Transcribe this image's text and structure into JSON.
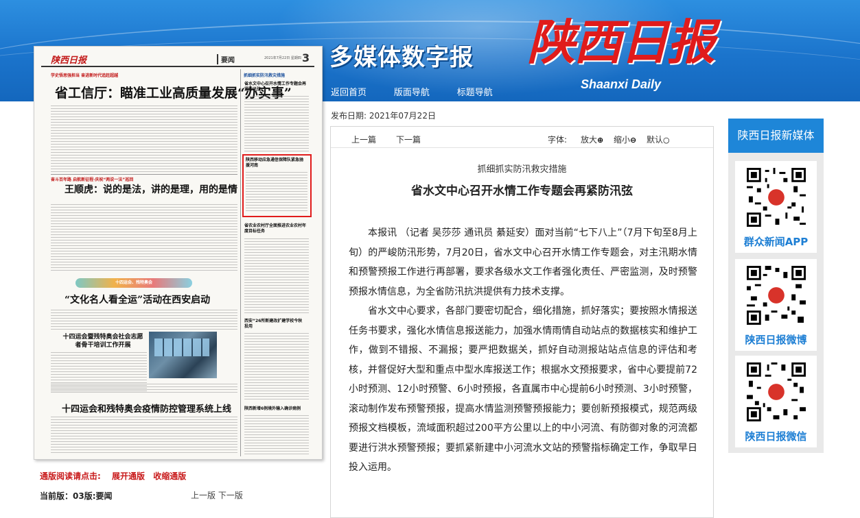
{
  "header": {
    "site_title": "多媒体数字报",
    "logo_cn": "陕西日报",
    "logo_en": "Shaanxi Daily",
    "nav": [
      "返回首页",
      "版面导航",
      "标题导航"
    ]
  },
  "newspaper_page": {
    "masthead_logo": "陕西日报",
    "section": "要闻",
    "date": "2021年7月22日 星期四",
    "page_number": "3",
    "kicker_1": "学史悟思强担当 奋进新时代追赶超越",
    "headline_1": "省工信厅：瞄准工业高质量发展“办实事”",
    "kicker_2": "奋斗百年路 启航新征程·庆祝“两说一法”巡回",
    "headline_2": "王顺虎：说的是法，讲的是理，用的是情",
    "ribbon": "十四运会、残特奥会",
    "headline_3": "“文化名人看全运”活动在西安启动",
    "headline_4": "十四运会暨残特奥会社会志愿者骨干培训工作开展",
    "headline_5": "十四运会和残特奥会疫情防控管理系统上线",
    "side_kicker": "抓细抓实防汛救灾措施",
    "side_h1": "省水文中心召开水情工作专题会再紧防汛弦",
    "side_h2": "陕西移动应急通信保障队紧急驰援河南",
    "side_h3": "省农业农村厅全面推进农业农村年度目标任务",
    "side_h4": "西安“26所新建改扩建学校今秋投用",
    "side_h5": "陕西新增6例境外输入确诊病例"
  },
  "publish_date_label": "发布日期:",
  "publish_date": "2021年07月22日",
  "article": {
    "toolbar": {
      "prev": "上一篇",
      "next": "下一篇",
      "font_label": "字体:",
      "enlarge": "放大",
      "enlarge_icon": "⊕",
      "shrink": "缩小",
      "shrink_icon": "⊖",
      "default": "默认",
      "default_icon": "○"
    },
    "kicker": "抓细抓实防汛救灾措施",
    "title": "省水文中心召开水情工作专题会再紧防汛弦",
    "paragraphs": [
      "本报讯 （记者 吴莎莎 通讯员 綦延安）面对当前“七下八上”（7月下旬至8月上旬）的严峻防汛形势，7月20日，省水文中心召开水情工作专题会，对主汛期水情和预警预报工作进行再部署，要求各级水文工作者强化责任、严密监测，及时预警预报水情信息，为全省防汛抗洪提供有力技术支撑。",
      "省水文中心要求，各部门要密切配合，细化措施，抓好落实；要按照水情报送任务书要求，强化水情信息报送能力，加强水情雨情自动站点的数据核实和维护工作，做到不错报、不漏报；要严把数据关，抓好自动测报站站点信息的评估和考核，并督促好大型和重点中型水库报送工作；根据水文预报要求，省中心要提前72小时预测、12小时预警、6小时预报，各直属市中心提前6小时预测、3小时预警，滚动制作发布预警预报，提高水情监测预警预报能力；要创新预报模式，规范两级预报文档模板，流域面积超过200平方公里以上的中小河流、有防御对象的河流都要进行洪水预警预报；要抓紧新建中小河流水文站的预警指标确定工作，争取早日投入运用。"
    ]
  },
  "reading": {
    "hint": "通版阅读请点击:",
    "expand": "展开通版",
    "collapse": "收缩通版",
    "current_edition": "当前版：03版:要闻",
    "prev_edition": "上一版",
    "next_edition": "下一版"
  },
  "sidebar": {
    "title": "陕西日报新媒体",
    "cards": [
      {
        "label": "群众新闻APP",
        "icon": "qr-code-icon"
      },
      {
        "label": "陕西日报微博",
        "icon": "qr-code-icon"
      },
      {
        "label": "陕西日报微信",
        "icon": "qr-code-icon"
      }
    ]
  },
  "colors": {
    "banner_blue": "#1b74cc",
    "logo_red": "#e01b1b",
    "link_red": "#c8191a",
    "sidebar_blue": "#1e86d8",
    "qr_label_blue": "#1e7fd4"
  }
}
